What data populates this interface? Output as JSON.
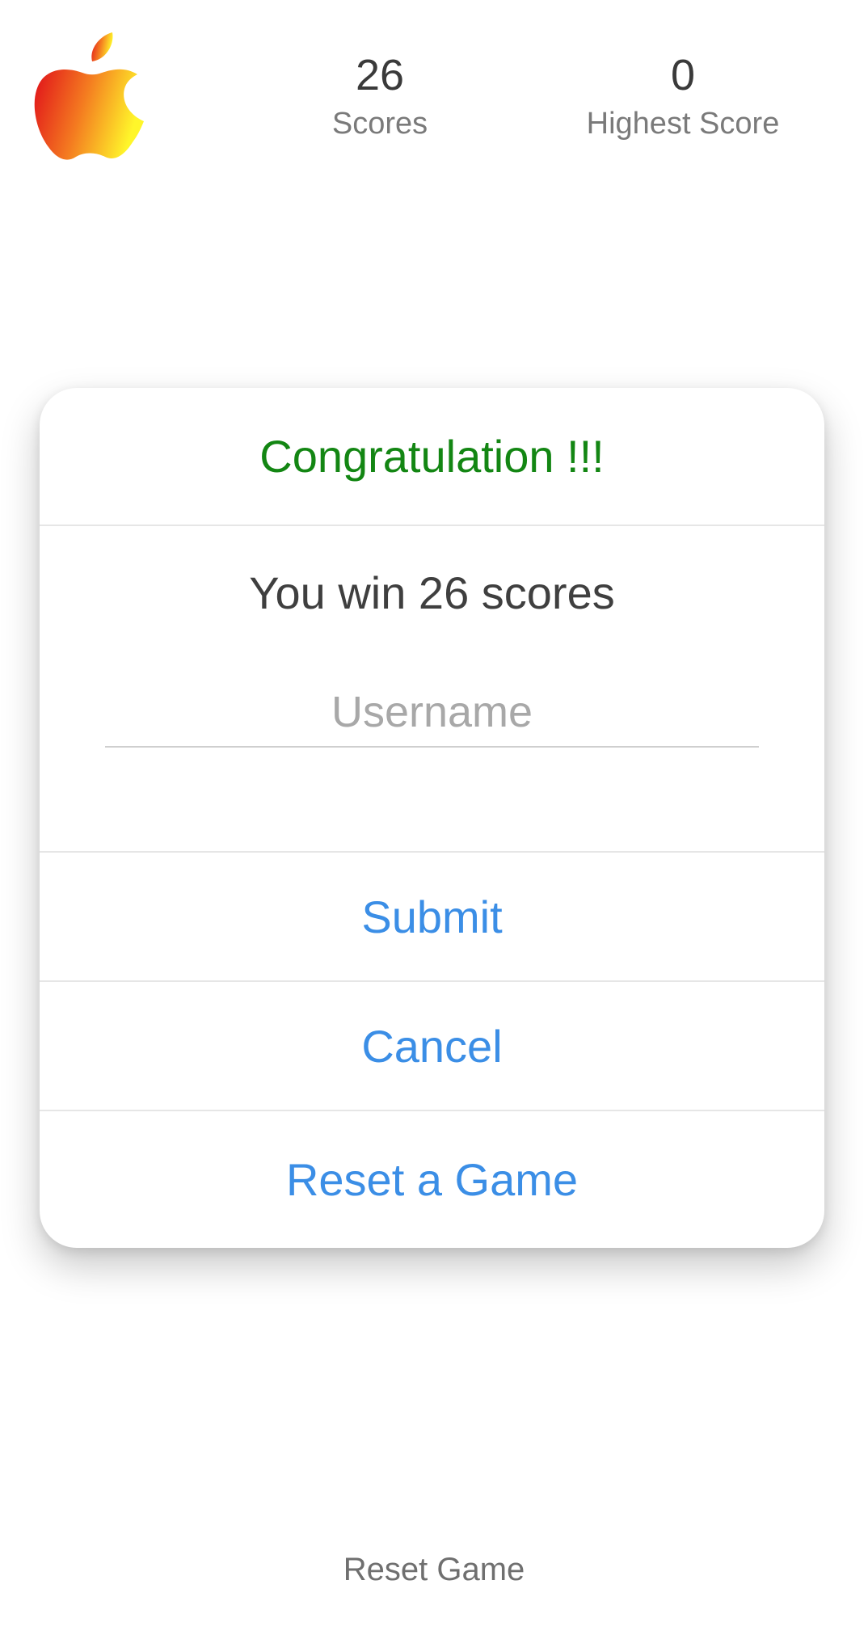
{
  "header": {
    "logo_icon": "apple-icon",
    "scores": {
      "value": "26",
      "label": "Scores"
    },
    "highest_score": {
      "value": "0",
      "label": "Highest Score"
    }
  },
  "dialog": {
    "title": "Congratulation !!!",
    "message": "You win 26 scores",
    "username": {
      "value": "",
      "placeholder": "Username"
    },
    "buttons": {
      "submit": "Submit",
      "cancel": "Cancel",
      "reset": "Reset a Game"
    }
  },
  "footer": {
    "reset_label": "Reset Game"
  },
  "colors": {
    "title_green": "#138613",
    "button_blue": "#3b8ee6",
    "logo_gradient": [
      "#e0101a",
      "#f47a20",
      "#fff62a"
    ]
  }
}
